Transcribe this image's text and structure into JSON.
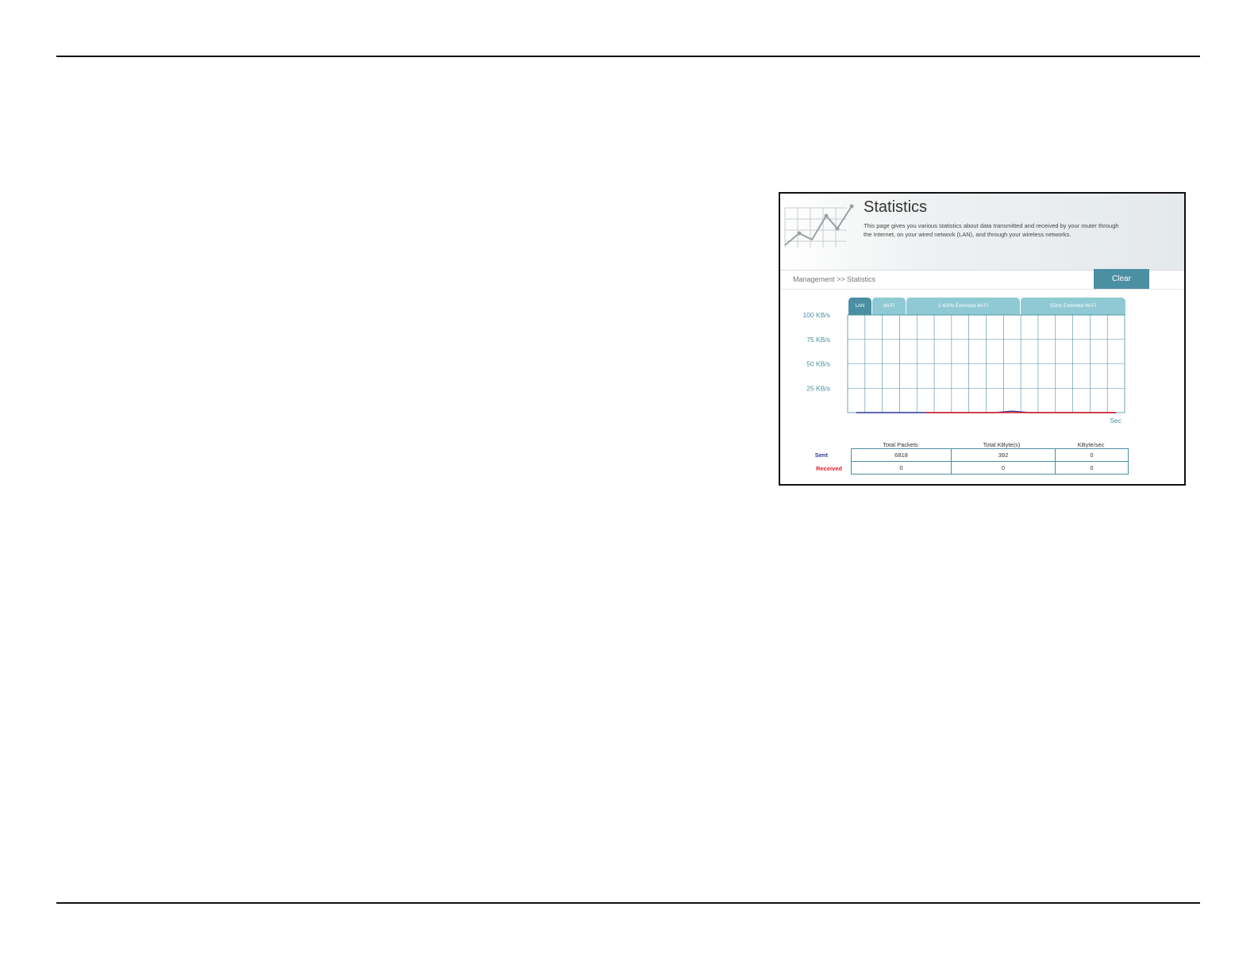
{
  "page": {
    "title": "Statistics",
    "description": "This page gives you various statistics about data transmitted and received by your router through the Internet, on your wired network (LAN), and through your wireless networks.",
    "breadcrumb": "Management >> Statistics",
    "clear_label": "Clear"
  },
  "tabs": [
    {
      "label": "LAN",
      "active": true
    },
    {
      "label": "Wi-Fi",
      "active": false
    },
    {
      "label": "2.4GHz Extended Wi-Fi",
      "active": false
    },
    {
      "label": "5GHz Extended Wi-Fi",
      "active": false
    }
  ],
  "chart_data": {
    "type": "line",
    "y_tick_labels": [
      "100 KB/s",
      "75 KB/s",
      "50 KB/s",
      "25 KB/s"
    ],
    "y_ticks": [
      100,
      75,
      50,
      25
    ],
    "ylim": [
      0,
      100
    ],
    "x_unit_label": "Sec",
    "x_slots": 16,
    "grid": true,
    "series": [
      {
        "name": "Sent",
        "color": "#2a3a9a",
        "values": [
          0,
          0,
          0,
          0,
          0,
          0,
          0,
          0,
          0,
          1.5,
          0,
          0,
          0,
          0,
          0,
          0
        ]
      },
      {
        "name": "Received",
        "color": "#e0202a",
        "values": [
          null,
          null,
          null,
          null,
          0,
          0,
          0,
          0,
          0,
          0,
          0,
          0,
          0,
          0,
          0,
          0
        ]
      }
    ]
  },
  "stats": {
    "columns": [
      "Total Packets",
      "Total KByte(s)",
      "KByte/sec"
    ],
    "rows": [
      {
        "label": "Sent",
        "values": [
          "6818",
          "392",
          "0"
        ]
      },
      {
        "label": "Received",
        "values": [
          "0",
          "0",
          "0"
        ]
      }
    ]
  },
  "colors": {
    "accent": "#4b8fa3",
    "tab_inactive": "#8fc9d4",
    "grid": "#4b8fa3",
    "sent": "#2a3a9a",
    "received": "#e0202a"
  }
}
